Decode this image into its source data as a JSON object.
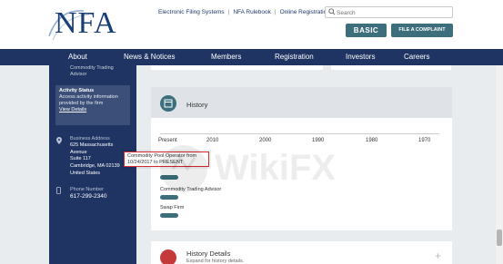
{
  "header": {
    "logo": "NFA",
    "links": [
      "Electronic Filing Systems",
      "NFA Rulebook",
      "Online Registration System"
    ],
    "search_placeholder": "Search",
    "basic_label": "BASIC",
    "complaint_label": "FILE A COMPLAINT"
  },
  "nav": {
    "items": [
      "About",
      "News & Notices",
      "Members",
      "Registration",
      "Investors",
      "Careers"
    ]
  },
  "sidebar": {
    "faded_top": "Commodity Trading",
    "faded_advisor": "Advisor",
    "activity": {
      "title": "Activity Status",
      "desc": "Access activity information provided by the firm",
      "link": "View Details"
    },
    "address": {
      "title": "Business Address",
      "lines": [
        "625 Massachusetts",
        "Avenue",
        "Suite 117",
        "Cambridge, MA 02139",
        "United States"
      ]
    },
    "phone": {
      "title": "Phone Number",
      "number": "617-299-2340"
    }
  },
  "history": {
    "title": "History",
    "ticks": [
      "Present",
      "2010",
      "2000",
      "1990",
      "1980",
      "1970"
    ],
    "tooltip": "Commodity Pool Operator from 10/24/2017 to PRESENT",
    "labels": [
      "Commodity Trading Advisor",
      "Swap Firm"
    ]
  },
  "details": {
    "title": "History Details",
    "subtitle": "Expand for history details."
  },
  "watermark": "WikiFX",
  "colors": {
    "navy": "#1f3462",
    "teal": "#3d6e7c",
    "tooltip_border": "#d6292f"
  }
}
